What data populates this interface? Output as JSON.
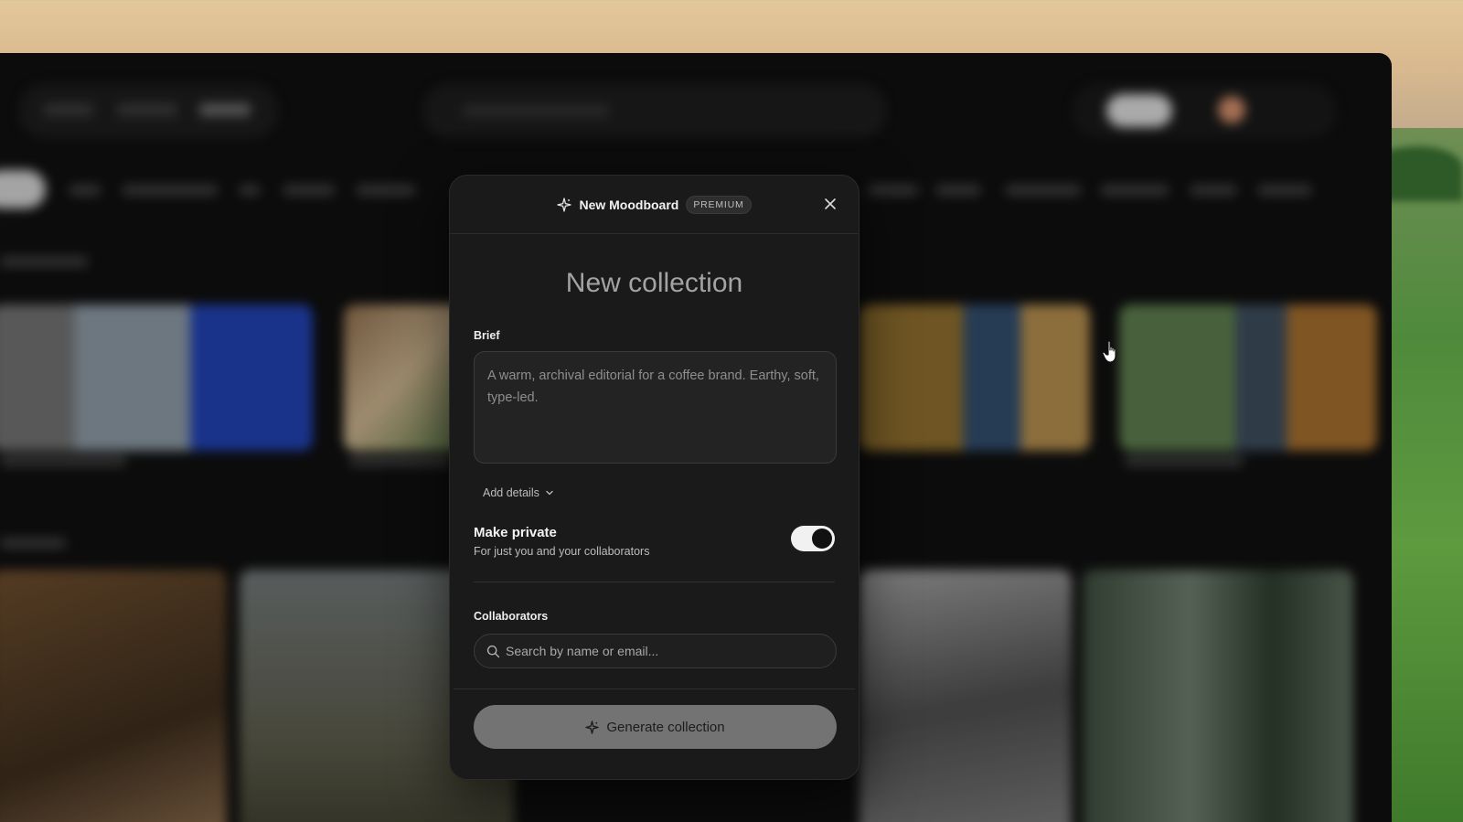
{
  "modal": {
    "header_title": "New Moodboard",
    "badge": "PREMIUM",
    "heading": "New collection",
    "brief": {
      "label": "Brief",
      "placeholder": "A warm, archival editorial for a coffee brand. Earthy, soft, type-led."
    },
    "add_details": "Add details",
    "private": {
      "title": "Make private",
      "subtitle": "For just you and your collaborators",
      "enabled": true
    },
    "collaborators": {
      "label": "Collaborators",
      "placeholder": "Search by name or email..."
    },
    "generate_label": "Generate collection"
  },
  "icons": {
    "header": "sparkle-icon",
    "close": "close-icon",
    "add_details": "chevron-down-icon",
    "search": "search-icon",
    "generate": "sparkle-icon",
    "cursor": "hand-pointer-icon"
  },
  "colors": {
    "modal_bg": "#1a1a1a",
    "button_bg": "#737373",
    "toggle_on": "#f1f1f1"
  }
}
